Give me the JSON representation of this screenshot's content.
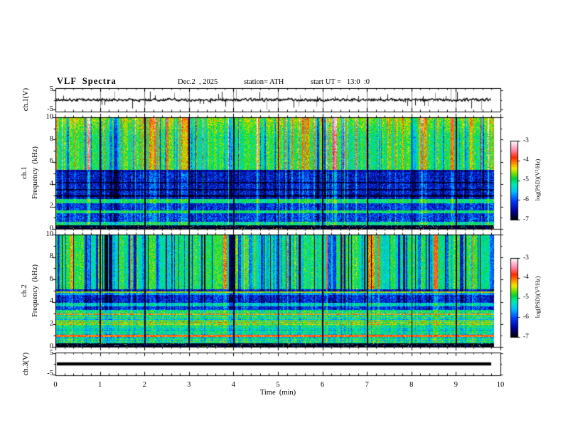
{
  "header": {
    "title": "VLF  Spectra",
    "date": "Dec.2  , 2025",
    "station": "station= ATH",
    "start_ut": "start UT =   13:0  :0"
  },
  "xaxis": {
    "label": "Time  (min)",
    "tick_labels": [
      "0",
      "1",
      "2",
      "3",
      "4",
      "5",
      "6",
      "7",
      "8",
      "9",
      "10"
    ],
    "range_min": [
      0,
      10
    ],
    "minor_step_min": 0.2
  },
  "panels": {
    "waveform": {
      "ylabel": "ch.1(V)",
      "ytick_labels": [
        "5",
        "-5"
      ],
      "ytick_values": [
        5,
        -5
      ],
      "yrange": [
        -6,
        6
      ]
    },
    "spec1": {
      "ylabel_channel": "ch.1",
      "ylabel_freq": "Frequency  (kHz)",
      "ytick_labels": [
        "10",
        "8",
        "6",
        "4",
        "2",
        "0"
      ],
      "ytick_values": [
        10,
        8,
        6,
        4,
        2,
        0
      ],
      "yrange": [
        0,
        10
      ]
    },
    "spec2": {
      "ylabel_channel": "ch.2",
      "ylabel_freq": "Frequency  (kHz)",
      "ytick_labels": [
        "10",
        "8",
        "6",
        "4",
        "2",
        "0"
      ],
      "ytick_values": [
        10,
        8,
        6,
        4,
        2,
        0
      ],
      "yrange": [
        0,
        10
      ]
    },
    "ch3": {
      "ylabel": "ch.3(V)",
      "ytick_labels": [
        "5",
        "-5"
      ],
      "ytick_values": [
        5,
        -5
      ],
      "yrange": [
        -5.5,
        5.5
      ]
    }
  },
  "colorbar": {
    "label": "log(PSD)(V²/Hz)",
    "tick_labels": [
      "-3",
      "-4",
      "-5",
      "-6",
      "-7"
    ],
    "tick_values": [
      -3,
      -4,
      -5,
      -6,
      -7
    ],
    "range": [
      -7,
      -3
    ],
    "stops": [
      [
        0,
        [
          0,
          0,
          0
        ]
      ],
      [
        0.115,
        [
          0,
          0,
          150
        ]
      ],
      [
        0.24,
        [
          0,
          60,
          255
        ]
      ],
      [
        0.36,
        [
          0,
          190,
          255
        ]
      ],
      [
        0.455,
        [
          0,
          235,
          170
        ]
      ],
      [
        0.525,
        [
          0,
          210,
          60
        ]
      ],
      [
        0.585,
        [
          110,
          225,
          0
        ]
      ],
      [
        0.65,
        [
          235,
          235,
          0
        ]
      ],
      [
        0.715,
        [
          255,
          150,
          0
        ]
      ],
      [
        0.79,
        [
          255,
          40,
          0
        ]
      ],
      [
        0.885,
        [
          255,
          135,
          175
        ]
      ],
      [
        1,
        [
          255,
          255,
          255
        ]
      ]
    ]
  },
  "chart_data": [
    {
      "id": "ch1_waveform",
      "type": "line",
      "panel": "waveform",
      "xlabel": "Time (min)",
      "ylabel": "ch.1(V)",
      "xlim": [
        0,
        10
      ],
      "ylim": [
        -6,
        6
      ],
      "x_extent": [
        0,
        9.8
      ],
      "series_desc": "broadband noise centred on 0 V (about ±1 V) with dense impulsive spikes reaching ±5 V",
      "core_sd_V": 0.5,
      "spike_prob": 0.06,
      "spike_max_V": 5,
      "grid": "thin vertical line at each minute"
    },
    {
      "id": "ch1_spectrogram",
      "type": "heatmap",
      "panel": "spec1",
      "xlim": [
        0,
        10
      ],
      "ylim": [
        0,
        10
      ],
      "zlabel": "log(PSD)(V²/Hz)",
      "zlim": [
        -7,
        -3
      ],
      "x_extent": [
        0,
        9.85
      ],
      "streak_profile": "hot",
      "minute_gridlines": "thin black vertical line each minute",
      "column_streaks": {
        "hot_frac": 0.2,
        "cold_frac": 0.13,
        "desc": "vertical striations: yellow/red hot columns, cyan/dark cold columns"
      },
      "bands": [
        {
          "f": [
            5.3,
            10
          ],
          "log_psd": -4.95,
          "streak_gain": 0.6,
          "noise": 0.38,
          "top_bias": true,
          "desc": "green with strong yellow/red and cyan vertical streaks"
        },
        {
          "f": [
            5.12,
            5.3
          ],
          "log_psd": -6.5,
          "streak_gain": 0.25,
          "noise": 0.3,
          "desc": "dark dividing line"
        },
        {
          "f": [
            2.65,
            5.12
          ],
          "log_psd": -6.3,
          "streak_gain": 0.32,
          "noise": 0.5,
          "dark_rows": [
            4.15,
            3.5,
            2.95
          ],
          "desc": "dark blue speckle band"
        },
        {
          "f": [
            2.3,
            2.65
          ],
          "log_psd": -5.05,
          "streak_gain": 0.22,
          "noise": 0.35,
          "desc": "green band"
        },
        {
          "f": [
            1.65,
            2.3
          ],
          "log_psd": -6.15,
          "streak_gain": 0.28,
          "noise": 0.5,
          "desc": "blue speckle"
        },
        {
          "f": [
            1.42,
            1.65
          ],
          "log_psd": -5.0,
          "streak_gain": 0.18,
          "noise": 0.3,
          "desc": "green band"
        },
        {
          "f": [
            0.62,
            1.42
          ],
          "log_psd": -6.1,
          "streak_gain": 0.28,
          "noise": 0.55,
          "desc": "blue/cyan speckle"
        },
        {
          "f": [
            0.3,
            0.62
          ],
          "log_psd": -5.15,
          "streak_gain": 0.2,
          "noise": 0.5,
          "desc": "green/cyan band"
        },
        {
          "f": [
            0,
            0.3
          ],
          "log_psd": -6.9,
          "streak_gain": 0.05,
          "noise": 0.25,
          "speckle": 0.09,
          "desc": "black base band with bright specks"
        }
      ]
    },
    {
      "id": "ch2_spectrogram",
      "type": "heatmap",
      "panel": "spec2",
      "xlim": [
        0,
        10
      ],
      "ylim": [
        0,
        10
      ],
      "zlabel": "log(PSD)(V²/Hz)",
      "zlim": [
        -7,
        -3
      ],
      "x_extent": [
        0,
        9.85
      ],
      "streak_profile": "cold",
      "minute_gridlines": "black vertical line each minute",
      "column_streaks": {
        "hot_frac": 0.05,
        "cold_frac": 0.33,
        "desc": "vertical striations: dark-blue/black cold columns dominate, few yellow"
      },
      "bands": [
        {
          "f": [
            5.15,
            10
          ],
          "log_psd": -5.0,
          "streak_gain": 0.75,
          "noise": 0.35,
          "desc": "green with dark blue / black vertical streaks"
        },
        {
          "f": [
            4.92,
            5.15
          ],
          "log_psd": -6.2,
          "streak_gain": 0.3,
          "noise": 0.45,
          "desc": "dark speckle row"
        },
        {
          "f": [
            4.78,
            4.92
          ],
          "log_psd": -4.5,
          "streak_gain": 0.1,
          "noise": 0.45,
          "desc": "orange line"
        },
        {
          "f": [
            4.62,
            4.78
          ],
          "log_psd": -5.6,
          "streak_gain": 0.2,
          "noise": 0.4,
          "desc": "dim row"
        },
        {
          "f": [
            3.95,
            4.62
          ],
          "log_psd": -6.15,
          "streak_gain": 0.3,
          "noise": 0.5,
          "desc": "blue speckle band"
        },
        {
          "f": [
            3.6,
            3.95
          ],
          "log_psd": -5.25,
          "streak_gain": 0.25,
          "noise": 0.4,
          "desc": "green-cyan"
        },
        {
          "f": [
            3.32,
            3.6
          ],
          "log_psd": -6.05,
          "streak_gain": 0.25,
          "noise": 0.5,
          "desc": "blue speckle"
        },
        {
          "f": [
            2.98,
            3.32
          ],
          "log_psd": -5.1,
          "streak_gain": 0.2,
          "noise": 0.4,
          "hstripe": 0.25,
          "desc": "green"
        },
        {
          "f": [
            2.84,
            2.98
          ],
          "log_psd": -4.2,
          "streak_gain": 0.1,
          "noise": 0.5,
          "desc": "red/orange dashed line"
        },
        {
          "f": [
            1.78,
            2.84
          ],
          "log_psd": -4.95,
          "streak_gain": 0.18,
          "noise": 0.4,
          "hstripe": 0.45,
          "desc": "yellow-green horizontal stripes"
        },
        {
          "f": [
            1.1,
            1.78
          ],
          "log_psd": -5.2,
          "streak_gain": 0.2,
          "noise": 0.42,
          "hstripe": 0.35,
          "desc": "green/cyan stripes"
        },
        {
          "f": [
            0.9,
            1.1
          ],
          "log_psd": -3.95,
          "streak_gain": 0.05,
          "noise": 0.3,
          "desc": "strong red/orange line"
        },
        {
          "f": [
            0.34,
            0.9
          ],
          "log_psd": -5.15,
          "streak_gain": 0.2,
          "noise": 0.5,
          "hstripe": 0.3,
          "desc": "green/cyan"
        },
        {
          "f": [
            0,
            0.34
          ],
          "log_psd": -6.9,
          "streak_gain": 0.05,
          "noise": 0.25,
          "speckle": 0.08,
          "desc": "black base band with specks"
        }
      ]
    },
    {
      "id": "ch3_waveform",
      "type": "line",
      "panel": "ch3",
      "xlim": [
        0,
        10
      ],
      "ylim": [
        -5.5,
        5.5
      ],
      "x_extent": [
        0,
        9.8
      ],
      "series_desc": "constant 0 V - thick flat black trace",
      "value_V": 0
    }
  ]
}
